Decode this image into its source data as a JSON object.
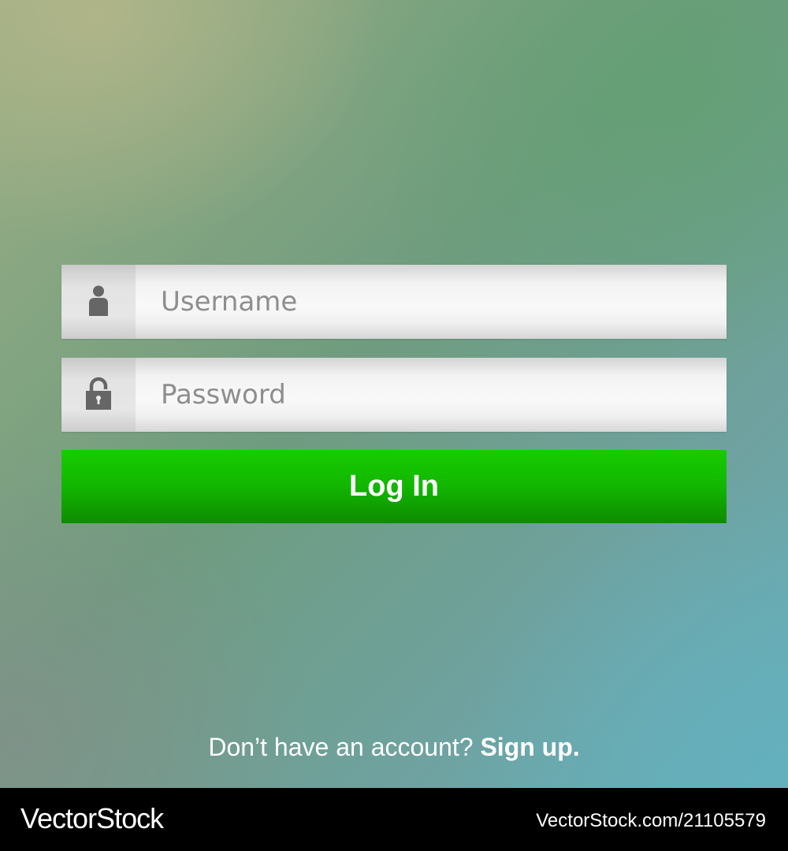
{
  "login_form": {
    "username": {
      "placeholder": "Username",
      "value": "",
      "icon": "user-icon"
    },
    "password": {
      "placeholder": "Password",
      "value": "",
      "icon": "lock-icon"
    },
    "login_button_label": "Log In"
  },
  "signup": {
    "prompt": "Don’t have an account?",
    "link_label": "Sign up."
  },
  "watermark": {
    "logo_text": "VectorStock",
    "id_text": "VectorStock.com/21105579"
  },
  "colors": {
    "button_green": "#12b600",
    "icon_gray": "#666666",
    "placeholder_gray": "#8e8e8e"
  }
}
